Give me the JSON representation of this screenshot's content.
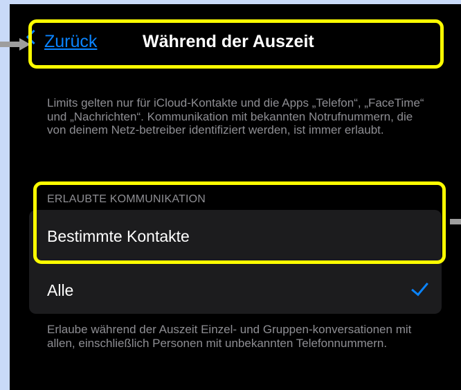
{
  "nav": {
    "back_label": "Zurück",
    "title": "Während der Auszeit"
  },
  "info_text": "Limits gelten nur für iCloud-Kontakte und die Apps „Telefon“, „FaceTime“ und „Nachrichten“. Kommunikation mit bekannten Notrufnummern, die von deinem Netz-betreiber identifiziert werden, ist immer erlaubt.",
  "section": {
    "header": "ERLAUBTE KOMMUNIKATION",
    "options": [
      {
        "label": "Bestimmte Kontakte",
        "selected": false
      },
      {
        "label": "Alle",
        "selected": true
      }
    ]
  },
  "footer_text": "Erlaube während der Auszeit Einzel- und Gruppen-konversationen mit allen, einschließlich Personen mit unbekannten Telefonnummern.",
  "colors": {
    "accent": "#0a84ff",
    "highlight": "#ffff00",
    "background_frame": "#c9daf8",
    "screen": "#000000",
    "row": "#1c1c1e",
    "secondary_text": "#8e8e93"
  },
  "icons": {
    "back": "chevron-left-icon",
    "selected": "checkmark-icon"
  }
}
